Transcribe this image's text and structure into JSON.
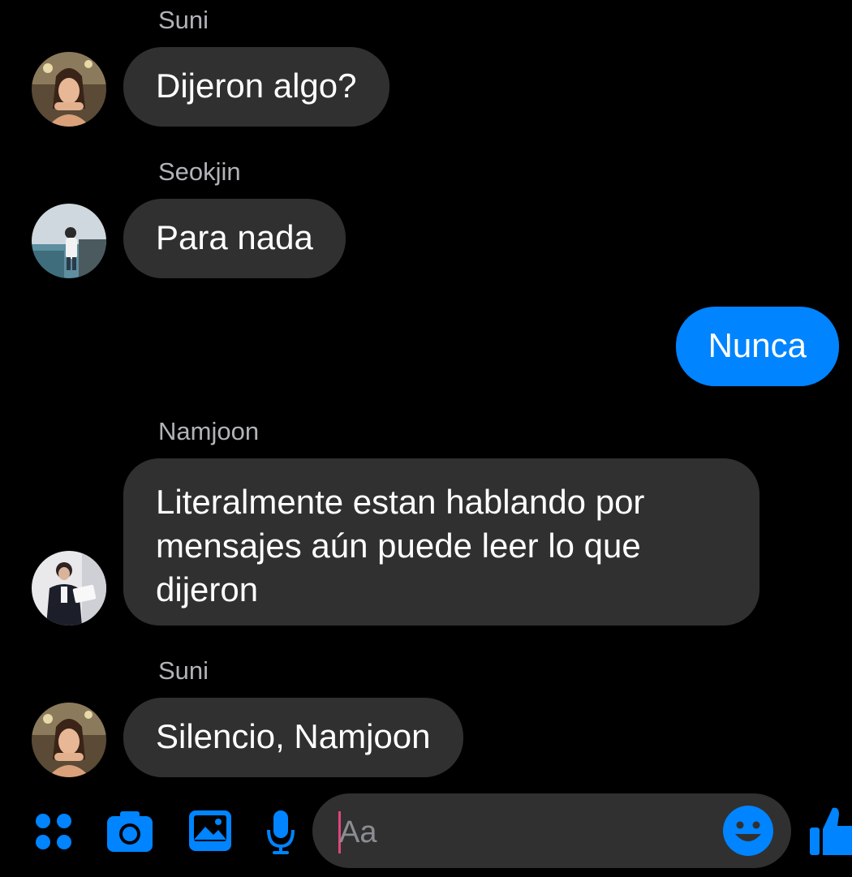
{
  "conversation": {
    "messages": [
      {
        "sender": "Suni",
        "text": "Dijeron algo?",
        "avatar_icon": "suni-avatar"
      },
      {
        "sender": "Seokjin",
        "text": "Para nada",
        "avatar_icon": "seokjin-avatar"
      },
      {
        "sender": "me",
        "text": "Nunca"
      },
      {
        "sender": "Namjoon",
        "text": "Literalmente estan hablando por mensajes aún puede leer lo que dijeron",
        "avatar_icon": "namjoon-avatar"
      },
      {
        "sender": "Suni",
        "text": "Silencio, Namjoon",
        "avatar_icon": "suni-avatar"
      }
    ]
  },
  "composer": {
    "placeholder": "Aa",
    "icons": [
      "apps-icon",
      "camera-icon",
      "gallery-icon",
      "microphone-icon",
      "emoji-icon",
      "thumbs-up-icon"
    ],
    "accent_color": "#0084ff"
  },
  "colors": {
    "background": "#000000",
    "incoming_bubble": "#303030",
    "outgoing_bubble": "#0084ff",
    "sender_name": "#b0b3b8"
  }
}
